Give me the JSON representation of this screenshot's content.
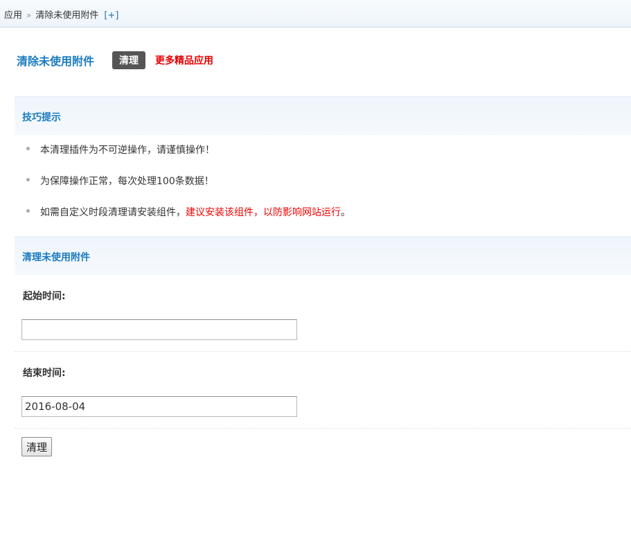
{
  "breadcrumb": {
    "root": "应用",
    "separator": "»",
    "current": "清除未使用附件",
    "add": "[+]"
  },
  "header": {
    "title": "清除未使用附件",
    "tab_label": "清理",
    "more_link": "更多精品应用"
  },
  "tips": {
    "title": "技巧提示",
    "items": [
      {
        "text": "本清理插件为不可逆操作，请谨慎操作！",
        "highlight": "",
        "suffix": ""
      },
      {
        "text": "为保障操作正常，每次处理100条数据！",
        "highlight": "",
        "suffix": ""
      },
      {
        "text": "如需自定义时段清理请安装组件，",
        "highlight": "建议安装该组件，以防影响网站运行",
        "suffix": "。"
      }
    ]
  },
  "form": {
    "title": "清理未使用附件",
    "start_label": "起始时间:",
    "start_value": "",
    "end_label": "结束时间:",
    "end_value": "2016-08-04",
    "submit_label": "清理"
  },
  "colors": {
    "accent": "#1a7bbf",
    "highlight": "#ee0000",
    "tab_bg": "#555555"
  }
}
